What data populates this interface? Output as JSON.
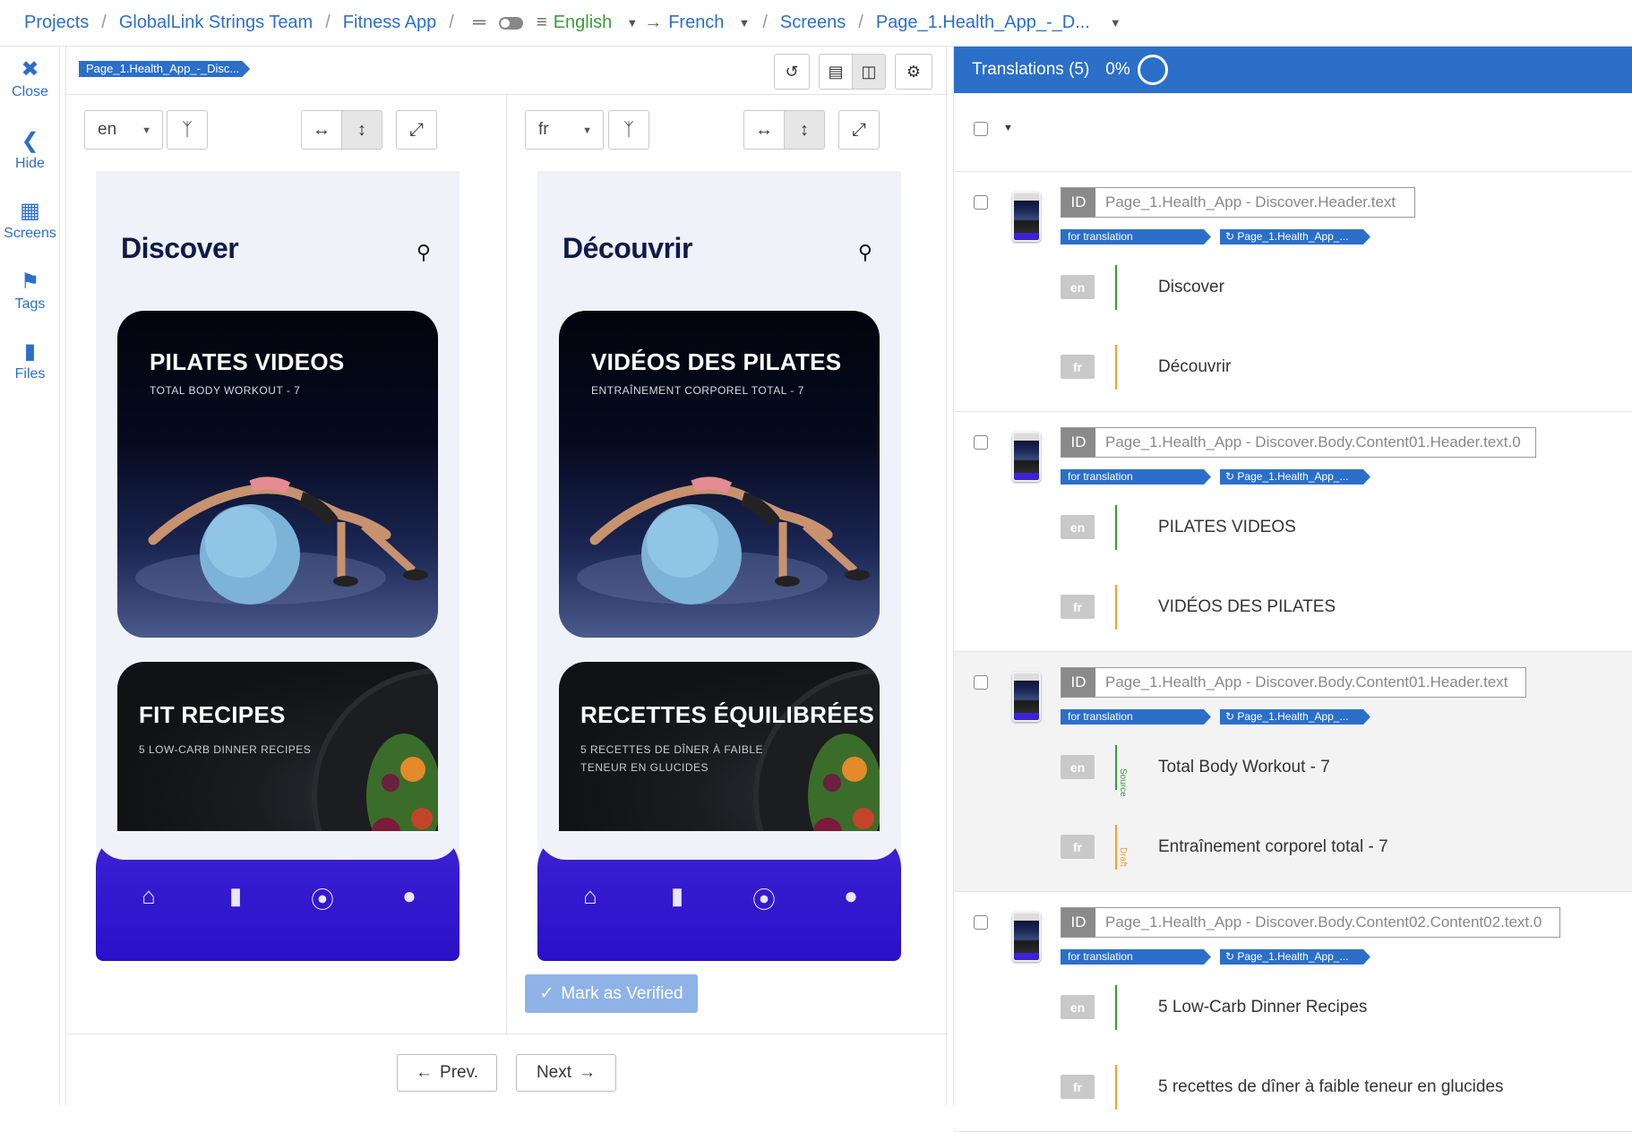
{
  "breadcrumb": {
    "items": [
      "Projects",
      "GlobalLink Strings Team",
      "Fitness App"
    ],
    "source_lang": "English",
    "target_lang": "French",
    "screens": "Screens",
    "page": "Page_1.Health_App_-_D..."
  },
  "rail": {
    "close": "Close",
    "hide": "Hide",
    "screens": "Screens",
    "tags": "Tags",
    "files": "Files"
  },
  "editor": {
    "page_tag": "Page_1.Health_App_-_Disc...",
    "left": {
      "lang": "en",
      "title": "Discover",
      "card1_title": "PILATES VIDEOS",
      "card1_sub": "TOTAL BODY WORKOUT - 7",
      "card2_title": "FIT RECIPES",
      "card2_sub": "5 LOW-CARB DINNER RECIPES"
    },
    "right": {
      "lang": "fr",
      "title": "Découvrir",
      "card1_title": "VIDÉOS DES PILATES",
      "card1_sub": "ENTRAÎNEMENT CORPOREL TOTAL - 7",
      "card2_title": "RECETTES ÉQUILIBRÉES",
      "card2_sub": "5 RECETTES DE DÎNER À FAIBLE TENEUR EN GLUCIDES"
    },
    "mark_verified": "Mark as Verified",
    "prev": "Prev.",
    "next": "Next"
  },
  "translations": {
    "header": "Translations (5)",
    "progress": "0%",
    "id_label": "ID",
    "tag_status": "for translation",
    "tag_page": "Page_1.Health_App_...",
    "source_label": "Source",
    "draft_label": "Draft",
    "entries": [
      {
        "id": "Page_1.Health_App - Discover.Header.text",
        "en": "Discover",
        "fr": "Découvrir"
      },
      {
        "id": "Page_1.Health_App - Discover.Body.Content01.Header.text.0",
        "en": "PILATES VIDEOS",
        "fr": "VIDÉOS DES PILATES"
      },
      {
        "id": "Page_1.Health_App - Discover.Body.Content01.Header.text",
        "en": "Total Body Workout - 7",
        "fr": "Entraînement corporel total - 7"
      },
      {
        "id": "Page_1.Health_App - Discover.Body.Content02.Content02.text.0",
        "en": "5 Low-Carb Dinner Recipes",
        "fr": "5 recettes de dîner à faible teneur en glucides"
      }
    ]
  }
}
